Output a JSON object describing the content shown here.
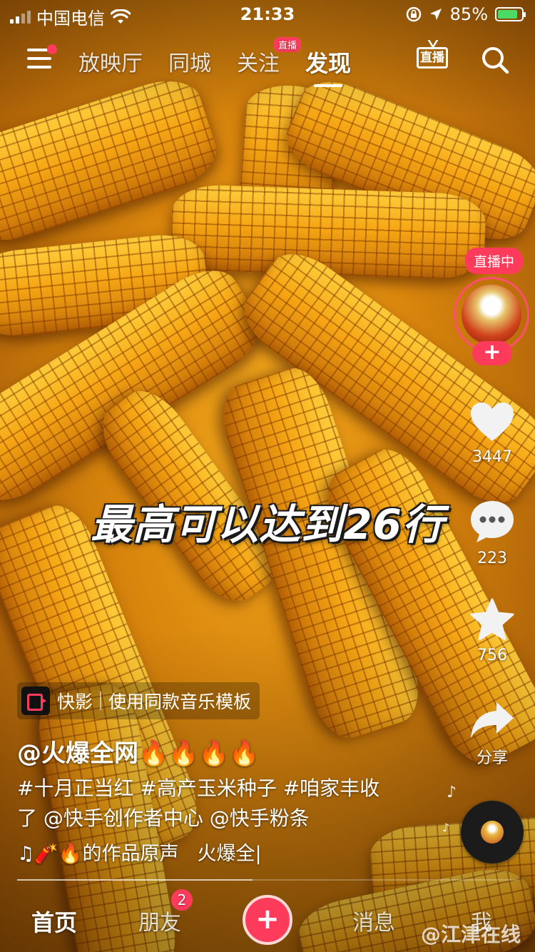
{
  "status_bar": {
    "carrier": "中国电信",
    "time": "21:33",
    "battery_percent": "85%",
    "battery_level": 0.85
  },
  "top_nav": {
    "tabs": [
      {
        "label": "放映厅"
      },
      {
        "label": "同城"
      },
      {
        "label": "关注",
        "badge": "直播"
      },
      {
        "label": "发现"
      }
    ],
    "active_tab": "发现",
    "live_label": "直播"
  },
  "creator": {
    "live_pill": "直播中",
    "follow_label": "+"
  },
  "actions": {
    "likes": "3447",
    "comments": "223",
    "favorites": "756",
    "share_label": "分享"
  },
  "video": {
    "caption": "最高可以达到26行"
  },
  "template_chip": {
    "app_name": "快影",
    "action_text": "使用同款音乐模板"
  },
  "post": {
    "author": "@火爆全网🔥🔥🔥🔥",
    "description_line1": "#十月正当红 #高产玉米种子 #咱家丰收",
    "description_line2": "了 @快手创作者中心 @快手粉条",
    "music_prefix": "♫🧨🔥的作品原声",
    "music_track": "火爆全|"
  },
  "progress": 0.47,
  "tab_bar": {
    "home": "首页",
    "friends": "朋友",
    "friends_badge": "2",
    "create": "+",
    "messages": "消息",
    "me": "我"
  },
  "watermark": "@江津在线",
  "colors": {
    "accent": "#ff3b5c",
    "corn": "#f6a614"
  }
}
